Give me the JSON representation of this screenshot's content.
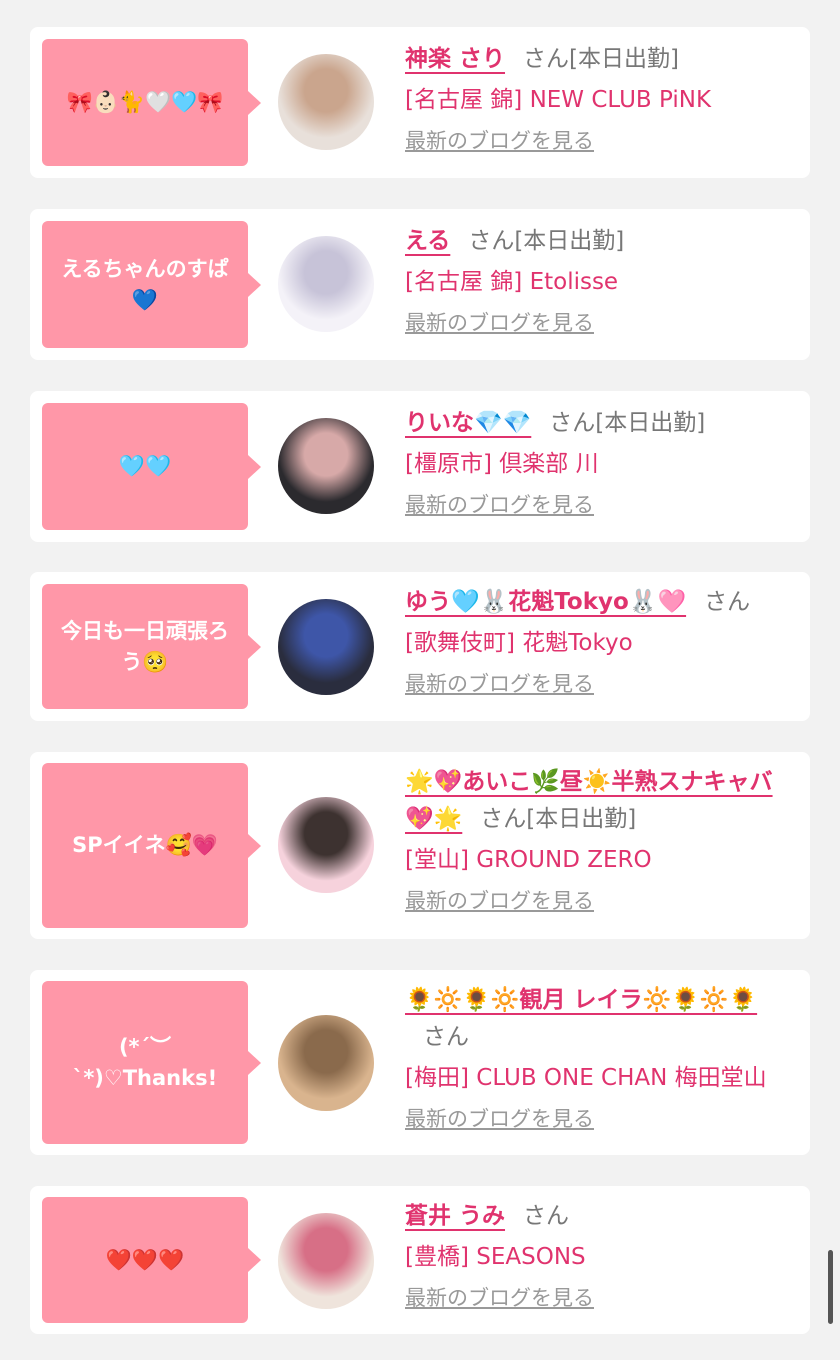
{
  "items": [
    {
      "bubble": "🎀👶🏻🐈🤍🩵🎀",
      "name": "神楽 さり",
      "san": "さん",
      "status": "[本日出勤]",
      "shop": "[名古屋 錦] NEW CLUB PiNK",
      "blog": "最新のブログを見る",
      "avatar_colors": [
        "#e8e0da",
        "#caa58d"
      ]
    },
    {
      "bubble": "えるちゃんのすぱ💙",
      "name": "える",
      "san": "さん",
      "status": "[本日出勤]",
      "shop": "[名古屋 錦] Etolisse",
      "blog": "最新のブログを見る",
      "avatar_colors": [
        "#f4f2f8",
        "#c7c3d8"
      ]
    },
    {
      "bubble": "🩵🩵",
      "name": "りいな💎💎",
      "san": "さん",
      "status": "[本日出勤]",
      "shop": "[橿原市] 倶楽部 川",
      "blog": "最新のブログを見る",
      "avatar_colors": [
        "#2b2a2e",
        "#d7a9a8"
      ]
    },
    {
      "bubble": "今日も一日頑張ろう🥺",
      "name": "ゆう🩵🐰花魁Tokyo🐰🩷",
      "san": "さん",
      "status": "",
      "shop": "[歌舞伎町] 花魁Tokyo",
      "blog": "最新のブログを見る",
      "avatar_colors": [
        "#2a2d3e",
        "#3e56a8"
      ]
    },
    {
      "bubble": "SPイイネ🥰💗",
      "name": "🌟💖あいこ🌿昼☀️半熟スナキャバ💖🌟",
      "san": "さん",
      "status": "[本日出勤]",
      "shop": "[堂山] GROUND ZERO",
      "blog": "最新のブログを見る",
      "avatar_colors": [
        "#f6d2dc",
        "#3d3230"
      ]
    },
    {
      "bubble": "(*´︶`*)♡Thanks!",
      "name": "🌻🔆🌻🔆観月 レイラ🔆🌻🔆🌻",
      "san": "さん",
      "status": "",
      "shop": "[梅田] CLUB ONE CHAN 梅田堂山",
      "blog": "最新のブログを見る",
      "avatar_colors": [
        "#d9b48e",
        "#8a6a4c"
      ]
    },
    {
      "bubble": "❤️❤️❤️",
      "name": "蒼井 うみ",
      "san": "さん",
      "status": "",
      "shop": "[豊橋] SEASONS",
      "blog": "最新のブログを見る",
      "avatar_colors": [
        "#efe4dc",
        "#d76f86"
      ]
    }
  ]
}
